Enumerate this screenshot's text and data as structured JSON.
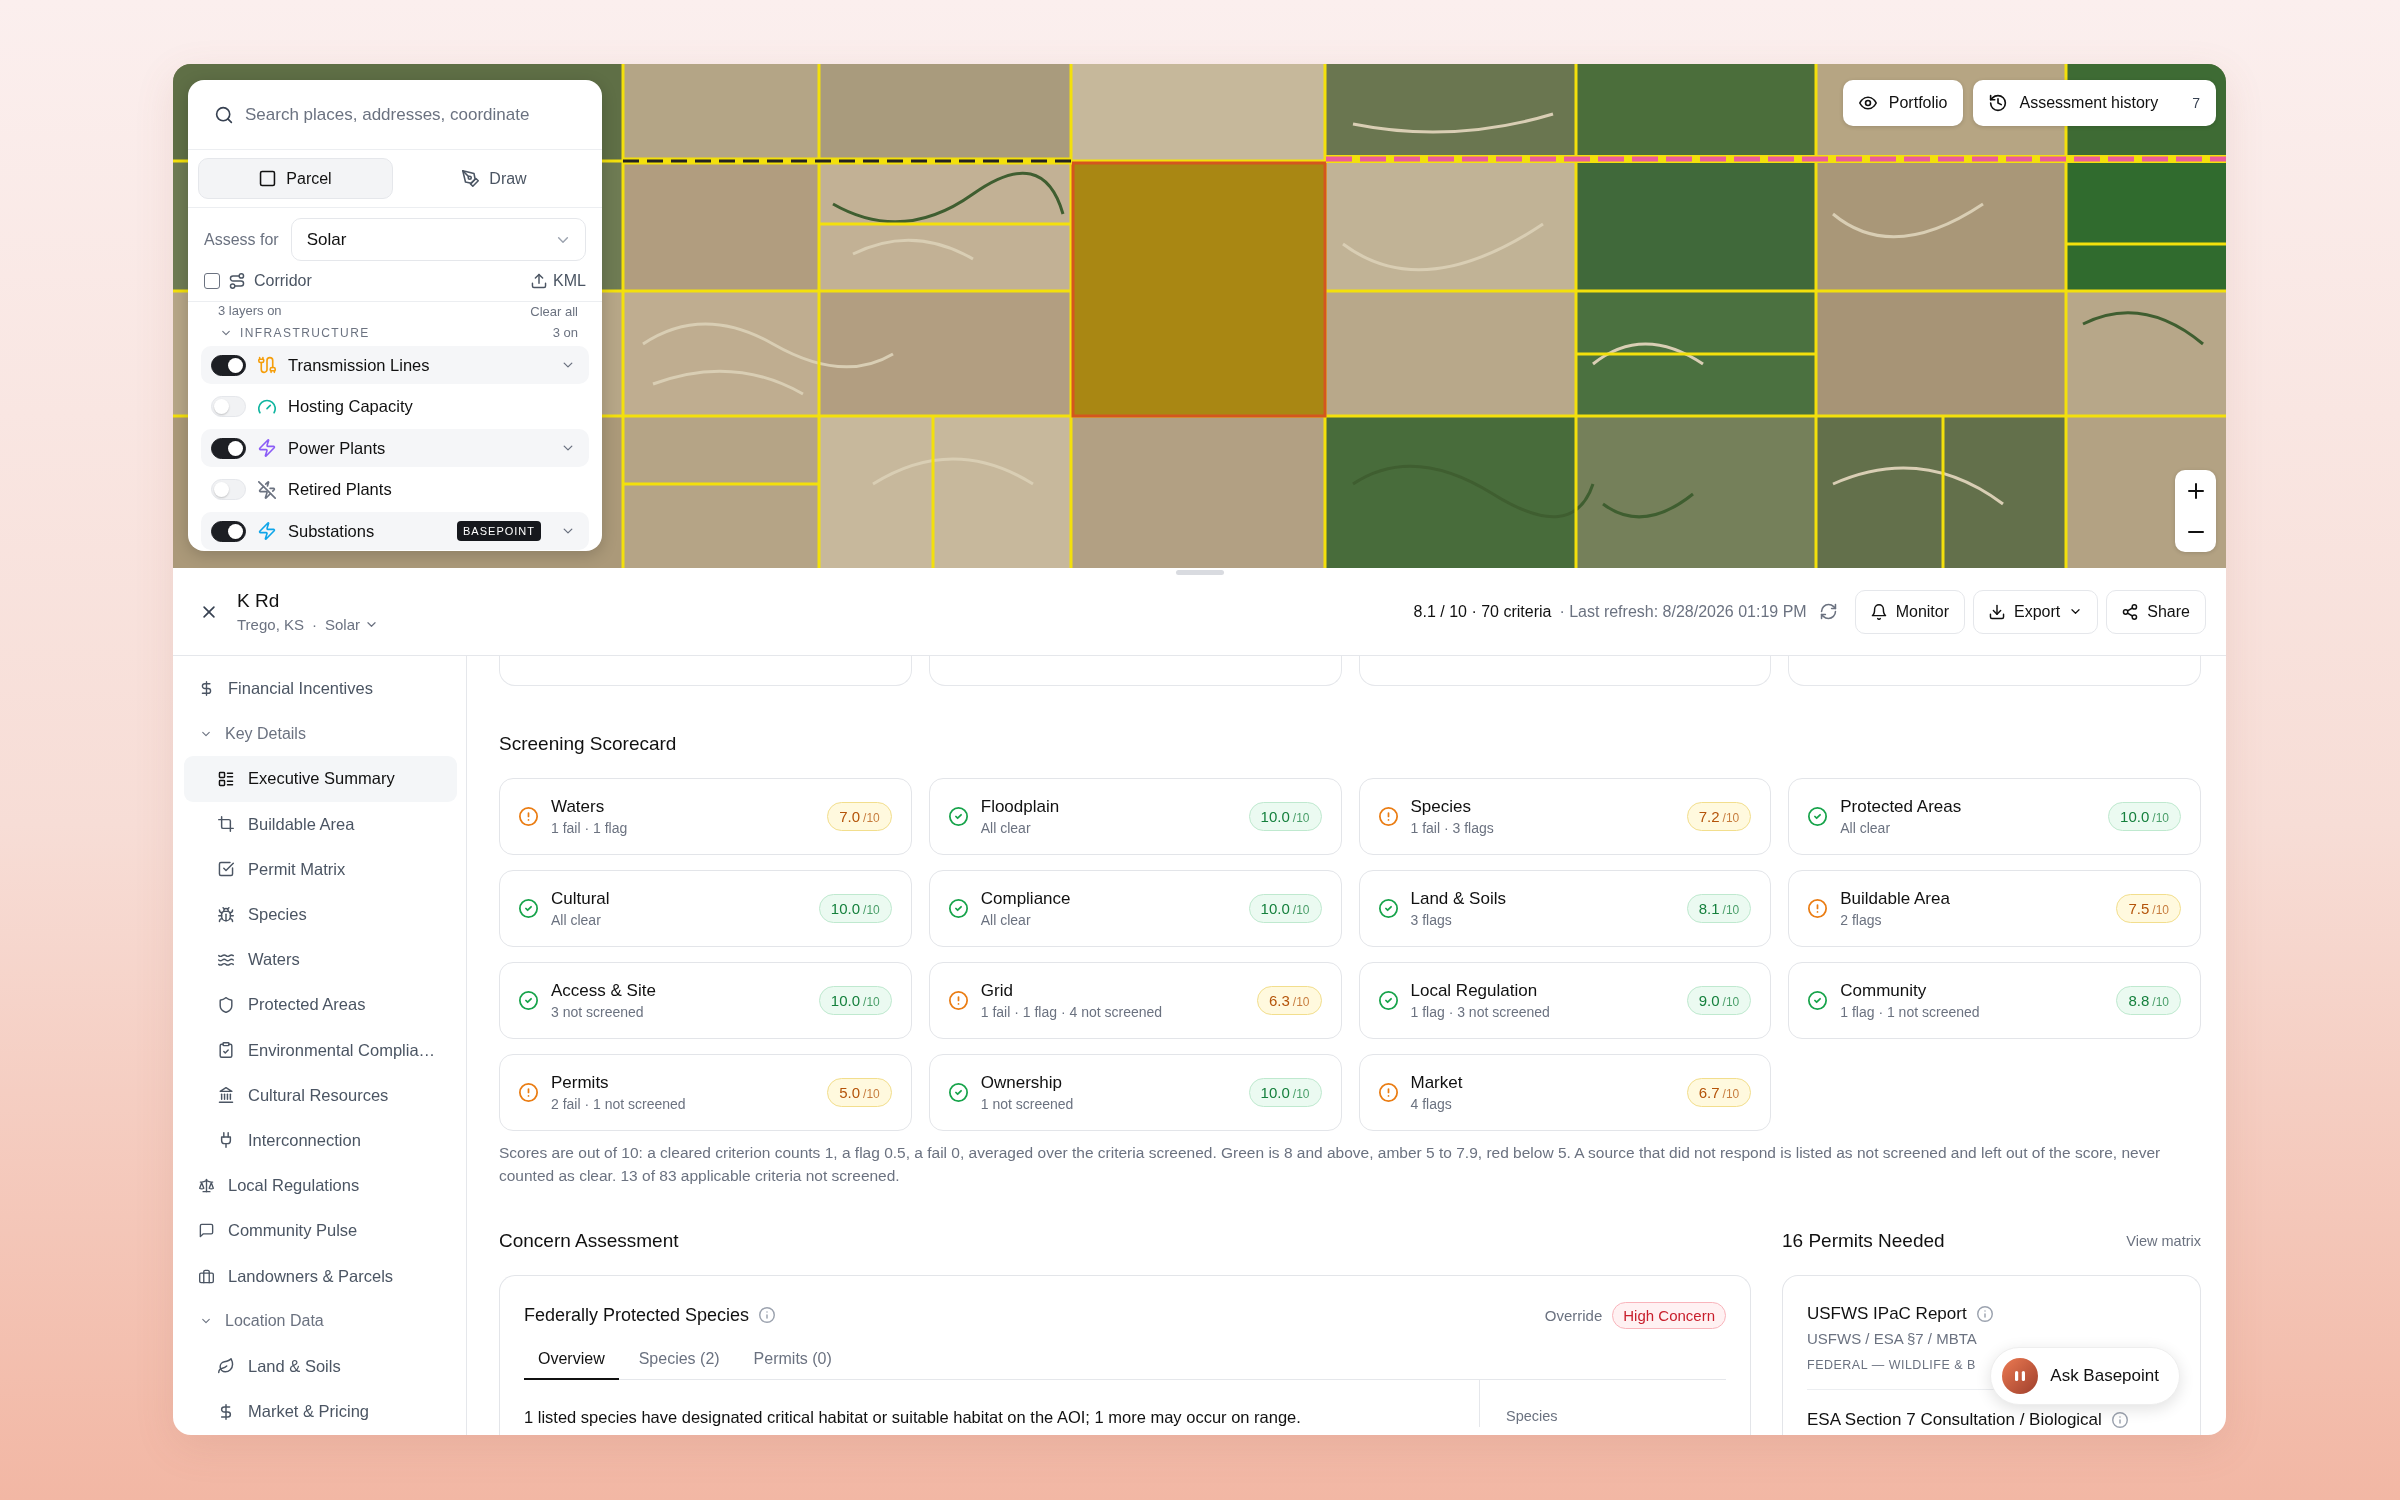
{
  "map": {
    "search": {
      "placeholder": "Search places, addresses, coordinate"
    },
    "modes": [
      {
        "label": "Parcel",
        "selected": true
      },
      {
        "label": "Draw",
        "selected": false
      }
    ],
    "assess_for": {
      "label": "Assess for",
      "value": "Solar"
    },
    "corridor": {
      "label": "Corridor",
      "checked": false
    },
    "kml": "KML",
    "layers_summary": "3 layers on",
    "clear_all": "Clear all",
    "layer_group": {
      "title": "INFRASTRUCTURE",
      "count": "3 on",
      "expanded": true,
      "layers": [
        {
          "label": "Transmission Lines",
          "on": true,
          "color": "#f59e0b"
        },
        {
          "label": "Hosting Capacity",
          "on": false,
          "color": "#10b5a0"
        },
        {
          "label": "Power Plants",
          "on": true,
          "color": "#8b5cf6"
        },
        {
          "label": "Retired Plants",
          "on": false,
          "color": "#6b7280"
        },
        {
          "label": "Substations",
          "on": true,
          "color": "#0ea5e9",
          "badge": "BASEPOINT"
        }
      ]
    },
    "portfolio": "Portfolio",
    "history": {
      "label": "Assessment history",
      "count": "7"
    }
  },
  "header": {
    "title": "K Rd",
    "location": "Trego, KS",
    "separator": "·",
    "use": "Solar",
    "score_summary": "8.1 / 10 · 70 criteria",
    "last_refresh": "· Last refresh: 8/28/2026 01:19 PM",
    "buttons": [
      {
        "label": "Monitor",
        "menu": false
      },
      {
        "label": "Export",
        "menu": true
      },
      {
        "label": "Share",
        "menu": false
      }
    ]
  },
  "sidebar": {
    "items": [
      {
        "label": "Financial Incentives",
        "selected": false
      },
      {
        "label": "Key Details",
        "selected": false,
        "expanded": true,
        "children": [
          {
            "label": "Executive Summary",
            "selected": true
          },
          {
            "label": "Buildable Area",
            "selected": false
          },
          {
            "label": "Permit Matrix",
            "selected": false
          },
          {
            "label": "Species",
            "selected": false
          },
          {
            "label": "Waters",
            "selected": false
          },
          {
            "label": "Protected Areas",
            "selected": false
          },
          {
            "label": "Environmental Complia…",
            "selected": false
          },
          {
            "label": "Cultural Resources",
            "selected": false
          },
          {
            "label": "Interconnection",
            "selected": false
          }
        ]
      },
      {
        "label": "Local Regulations",
        "selected": false
      },
      {
        "label": "Community Pulse",
        "selected": false
      },
      {
        "label": "Landowners & Parcels",
        "selected": false
      },
      {
        "label": "Location Data",
        "selected": false,
        "expanded": true,
        "children": [
          {
            "label": "Land & Soils",
            "selected": false
          },
          {
            "label": "Market & Pricing",
            "selected": false
          }
        ]
      }
    ]
  },
  "scorecard": {
    "title": "Screening Scorecard",
    "items": [
      {
        "title": "Waters",
        "detail": "1 fail · 1 flag",
        "score": "7.0",
        "scale": "/10",
        "kind": "warn"
      },
      {
        "title": "Floodplain",
        "detail": "All clear",
        "score": "10.0",
        "scale": "/10",
        "kind": "pass"
      },
      {
        "title": "Species",
        "detail": "1 fail · 3 flags",
        "score": "7.2",
        "scale": "/10",
        "kind": "warn"
      },
      {
        "title": "Protected Areas",
        "detail": "All clear",
        "score": "10.0",
        "scale": "/10",
        "kind": "pass"
      },
      {
        "title": "Cultural",
        "detail": "All clear",
        "score": "10.0",
        "scale": "/10",
        "kind": "pass"
      },
      {
        "title": "Compliance",
        "detail": "All clear",
        "score": "10.0",
        "scale": "/10",
        "kind": "pass"
      },
      {
        "title": "Land & Soils",
        "detail": "3 flags",
        "score": "8.1",
        "scale": "/10",
        "kind": "pass"
      },
      {
        "title": "Buildable Area",
        "detail": "2 flags",
        "score": "7.5",
        "scale": "/10",
        "kind": "warn"
      },
      {
        "title": "Access & Site",
        "detail": "3 not screened",
        "score": "10.0",
        "scale": "/10",
        "kind": "pass"
      },
      {
        "title": "Grid",
        "detail": "1 fail · 1 flag · 4 not screened",
        "score": "6.3",
        "scale": "/10",
        "kind": "warn"
      },
      {
        "title": "Local Regulation",
        "detail": "1 flag · 3 not screened",
        "score": "9.0",
        "scale": "/10",
        "kind": "pass"
      },
      {
        "title": "Community",
        "detail": "1 flag · 1 not screened",
        "score": "8.8",
        "scale": "/10",
        "kind": "pass"
      },
      {
        "title": "Permits",
        "detail": "2 fail · 1 not screened",
        "score": "5.0",
        "scale": "/10",
        "kind": "warn"
      },
      {
        "title": "Ownership",
        "detail": "1 not screened",
        "score": "10.0",
        "scale": "/10",
        "kind": "pass"
      },
      {
        "title": "Market",
        "detail": "4 flags",
        "score": "6.7",
        "scale": "/10",
        "kind": "warn"
      }
    ],
    "note": "Scores are out of 10: a cleared criterion counts 1, a flag 0.5, a fail 0, averaged over the criteria screened. Green is 8 and above, amber 5 to 7.9, red below 5. A source that did not respond is listed as not screened and left out of the score, never counted as clear. 13 of 83 applicable criteria not screened."
  },
  "concern_assessment": {
    "title": "Concern Assessment",
    "card": {
      "title": "Federally Protected Species",
      "override_label": "Override",
      "level_badge": {
        "label": "High Concern",
        "kind": "high"
      },
      "tabs": [
        {
          "label": "Overview",
          "selected": true
        },
        {
          "label": "Species (2)",
          "selected": false
        },
        {
          "label": "Permits (0)",
          "selected": false
        }
      ],
      "summary": "1 listed species have designated critical habitat or suitable habitat on the AOI; 1 more may occur on range.",
      "side_label": "Species"
    }
  },
  "permits": {
    "title": "16 Permits Needed",
    "link": "View matrix",
    "items": [
      {
        "title": "USFWS IPaC Report",
        "agencies": "USFWS / ESA §7 / MBTA",
        "category": "FEDERAL — WILDLIFE & B"
      },
      {
        "title": "ESA Section 7 Consultation / Biological"
      }
    ]
  },
  "assistant": {
    "label": "Ask Basepoint"
  }
}
